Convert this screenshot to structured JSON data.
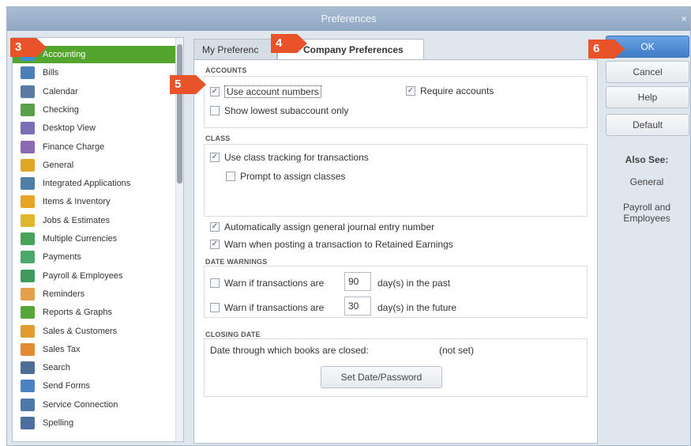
{
  "window": {
    "title": "Preferences",
    "close_glyph": "×"
  },
  "sidebar": {
    "items": [
      {
        "label": "Accounting",
        "icon": "accounting-icon",
        "color": "#3b8fd6",
        "selected": true
      },
      {
        "label": "Bills",
        "icon": "bills-icon",
        "color": "#4a7fb9"
      },
      {
        "label": "Calendar",
        "icon": "calendar-icon",
        "color": "#5b7aa3"
      },
      {
        "label": "Checking",
        "icon": "checking-icon",
        "color": "#5aa04a"
      },
      {
        "label": "Desktop View",
        "icon": "desktop-view-icon",
        "color": "#7a6fb5"
      },
      {
        "label": "Finance Charge",
        "icon": "finance-charge-icon",
        "color": "#8a6ab0"
      },
      {
        "label": "General",
        "icon": "general-icon",
        "color": "#e2a626"
      },
      {
        "label": "Integrated Applications",
        "icon": "integrated-applications-icon",
        "color": "#4f7fa8"
      },
      {
        "label": "Items & Inventory",
        "icon": "items-inventory-icon",
        "color": "#e7a323"
      },
      {
        "label": "Jobs & Estimates",
        "icon": "jobs-estimates-icon",
        "color": "#e0b62b"
      },
      {
        "label": "Multiple Currencies",
        "icon": "multiple-currencies-icon",
        "color": "#48a35a"
      },
      {
        "label": "Payments",
        "icon": "payments-icon",
        "color": "#4aa86a"
      },
      {
        "label": "Payroll & Employees",
        "icon": "payroll-employees-icon",
        "color": "#3f9a5b"
      },
      {
        "label": "Reminders",
        "icon": "reminders-icon",
        "color": "#e2a14a"
      },
      {
        "label": "Reports & Graphs",
        "icon": "reports-graphs-icon",
        "color": "#58a63a"
      },
      {
        "label": "Sales & Customers",
        "icon": "sales-customers-icon",
        "color": "#e29b2f"
      },
      {
        "label": "Sales Tax",
        "icon": "sales-tax-icon",
        "color": "#e28b33"
      },
      {
        "label": "Search",
        "icon": "search-icon",
        "color": "#4d6f96"
      },
      {
        "label": "Send Forms",
        "icon": "send-forms-icon",
        "color": "#4a82c4"
      },
      {
        "label": "Service Connection",
        "icon": "service-connection-icon",
        "color": "#4c79aa"
      },
      {
        "label": "Spelling",
        "icon": "spelling-icon",
        "color": "#4c6fa0"
      }
    ]
  },
  "tabs": [
    {
      "label": "My Preferenc",
      "active": false
    },
    {
      "label": "Company Preferences",
      "active": true
    }
  ],
  "accounts": {
    "section": "ACCOUNTS",
    "use_account_numbers": {
      "label": "Use account numbers",
      "checked": true
    },
    "require_accounts": {
      "label": "Require accounts",
      "checked": true
    },
    "show_lowest_subaccount": {
      "label": "Show lowest subaccount only",
      "checked": false
    }
  },
  "class": {
    "section": "CLASS",
    "use_class_tracking": {
      "label": "Use class tracking for transactions",
      "checked": true
    },
    "prompt_assign_classes": {
      "label": "Prompt to assign classes",
      "checked": false
    }
  },
  "general_options": {
    "auto_assign_journal": {
      "label": "Automatically assign general journal entry number",
      "checked": true
    },
    "warn_retained_earnings": {
      "label": "Warn when posting a transaction to Retained Earnings",
      "checked": true
    }
  },
  "date_warnings": {
    "section": "DATE WARNINGS",
    "past": {
      "label": "Warn if transactions are",
      "value": "90",
      "suffix": "day(s) in the past",
      "checked": false
    },
    "future": {
      "label": "Warn if transactions are",
      "value": "30",
      "suffix": "day(s) in the future",
      "checked": false
    }
  },
  "closing_date": {
    "section": "CLOSING DATE",
    "label": "Date through which books are closed:",
    "value": "(not set)",
    "button": "Set Date/Password"
  },
  "buttons": {
    "ok": "OK",
    "cancel": "Cancel",
    "help": "Help",
    "default": "Default"
  },
  "also_see": {
    "heading": "Also See:",
    "links": [
      "General",
      "Payroll and Employees"
    ]
  },
  "callouts": [
    "3",
    "4",
    "5",
    "6"
  ],
  "colors": {
    "accent": "#e8532a",
    "selected": "#54a52e",
    "ok_button": "#3f7cc8"
  }
}
